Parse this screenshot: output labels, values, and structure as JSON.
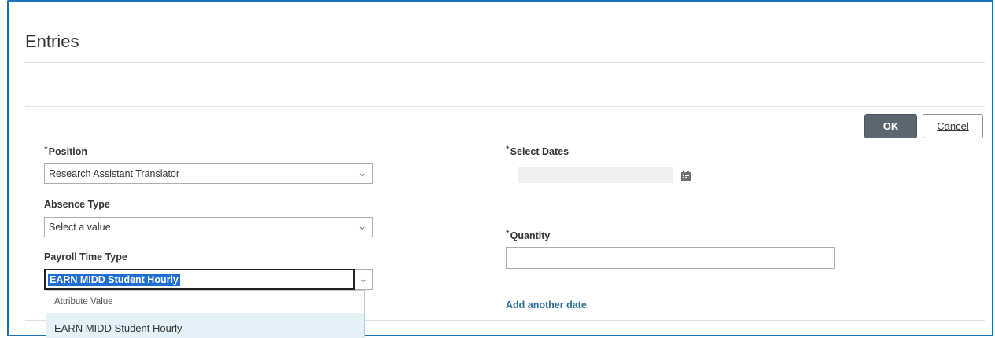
{
  "page": {
    "title": "Entries"
  },
  "toolbar": {
    "ok_label": "OK",
    "cancel_label": "Cancel"
  },
  "form": {
    "required_marker": "*",
    "position": {
      "label": "Position",
      "value": "Research Assistant Translator"
    },
    "absence_type": {
      "label": "Absence Type",
      "placeholder": "Select a value"
    },
    "payroll_time_type": {
      "label": "Payroll Time Type",
      "value": "EARN MIDD Student Hourly",
      "dropdown_header": "Attribute Value",
      "options": [
        "EARN MIDD Student Hourly"
      ]
    },
    "select_dates": {
      "label": "Select Dates"
    },
    "quantity": {
      "label": "Quantity",
      "value": ""
    },
    "add_date_link": "Add another date"
  },
  "icons": {
    "chevron": "chevron-down-icon",
    "calendar": "calendar-icon"
  },
  "colors": {
    "accent": "#1c75bc",
    "primary_button": "#5c6670",
    "selection": "#1e6ed4",
    "link": "#2c6e9e",
    "highlight_row": "#e4f1f8"
  }
}
